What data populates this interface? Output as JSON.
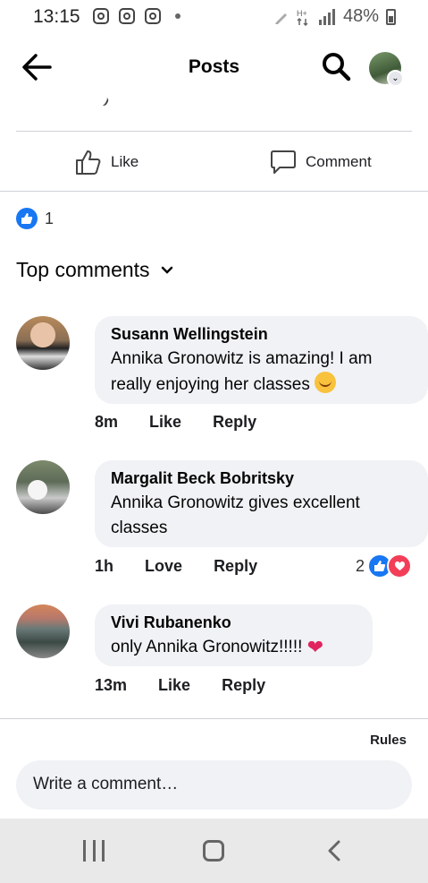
{
  "status_bar": {
    "time": "13:15",
    "battery": "48%"
  },
  "header": {
    "title": "Posts"
  },
  "actions": {
    "like": "Like",
    "comment": "Comment"
  },
  "post_reactions": {
    "count": "1"
  },
  "top_comments": {
    "label": "Top comments"
  },
  "comments": [
    {
      "author": "Susann Wellingstein",
      "text": "Annika Gronowitz is amazing! I am really enjoying her classes",
      "emoji": "smiling-face-with-hearts",
      "time": "8m",
      "react": "Like",
      "reply": "Reply"
    },
    {
      "author": "Margalit Beck Bobritsky",
      "text": "Annika Gronowitz gives excellent classes",
      "time": "1h",
      "react": "Love",
      "reply": "Reply",
      "reaction_count": "2"
    },
    {
      "author": "Vivi Rubanenko",
      "text": "only Annika Gronowitz!!!!!",
      "emoji": "red-heart",
      "time": "13m",
      "react": "Like",
      "reply": "Reply"
    }
  ],
  "footer": {
    "rules": "Rules",
    "composer_placeholder": "Write a comment…"
  },
  "colors": {
    "facebook_blue": "#1877f2",
    "love_red": "#f33e58",
    "bubble_gray": "#f0f2f5"
  }
}
